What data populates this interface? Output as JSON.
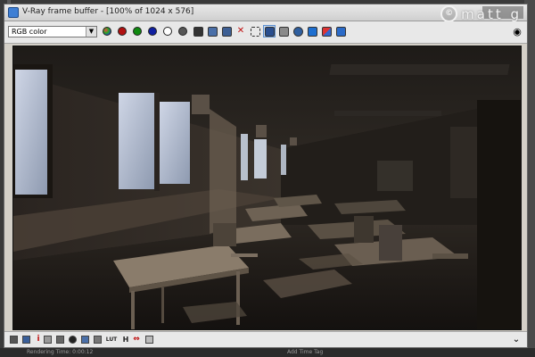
{
  "window": {
    "title": "V-Ray frame buffer - [100% of 1024 x 576]"
  },
  "watermark": {
    "symbol": "©",
    "text": "matt g"
  },
  "toolbar": {
    "channel_select": {
      "value": "RGB color",
      "options": [
        "RGB color"
      ]
    },
    "buttons": [
      {
        "name": "rgb-channels-icon",
        "glyph": "●"
      },
      {
        "name": "red-channel-icon",
        "glyph": "●",
        "color": "#b01010"
      },
      {
        "name": "green-channel-icon",
        "glyph": "●",
        "color": "#108a10"
      },
      {
        "name": "blue-channel-icon",
        "glyph": "●",
        "color": "#1020a0"
      },
      {
        "name": "alpha-channel-icon",
        "glyph": "○"
      },
      {
        "name": "monochrome-icon",
        "glyph": "●"
      },
      {
        "name": "save-icon",
        "glyph": "💾"
      },
      {
        "name": "save-all-icon",
        "glyph": "▤"
      },
      {
        "name": "load-icon",
        "glyph": "▦"
      },
      {
        "name": "clear-icon",
        "glyph": "✕"
      },
      {
        "name": "duplicate-icon",
        "glyph": "⧉"
      },
      {
        "name": "track-mouse-icon",
        "glyph": "⌖"
      },
      {
        "name": "render-region-icon",
        "glyph": "▣"
      },
      {
        "name": "teapot-render-icon",
        "glyph": "♨"
      },
      {
        "name": "camera-icon",
        "glyph": "▭"
      },
      {
        "name": "lens-effects-icon",
        "glyph": "◧"
      },
      {
        "name": "stamp-icon",
        "glyph": "▧"
      }
    ],
    "eye_icon": "👁"
  },
  "statusbar": {
    "buttons": [
      {
        "name": "color-correction-icon",
        "glyph": "▤"
      },
      {
        "name": "curve-icon",
        "glyph": "▥"
      },
      {
        "name": "info-icon",
        "glyph": "i"
      },
      {
        "name": "level-icon",
        "glyph": "▦"
      },
      {
        "name": "exposure-icon",
        "glyph": "▧"
      },
      {
        "name": "srgb-icon",
        "glyph": "◉"
      },
      {
        "name": "lut-icon",
        "glyph": "▩"
      },
      {
        "name": "ocio-icon",
        "glyph": "▨"
      },
      {
        "name": "lut-label",
        "glyph": "LUT"
      },
      {
        "name": "hist-label",
        "glyph": "H"
      },
      {
        "name": "compare-icon",
        "glyph": "⇔"
      },
      {
        "name": "pixel-aspect-icon",
        "glyph": "◫"
      }
    ],
    "expand_icon": "⌄"
  },
  "taskbar": {
    "items": [
      "Rendering Time: 0:00:12",
      "Add Time Tag"
    ]
  },
  "colors": {
    "chrome": "#d4d0c8",
    "toolbar": "#e8e8e8",
    "render_dark": "#1a1714",
    "accent": "#5b8fd0"
  }
}
